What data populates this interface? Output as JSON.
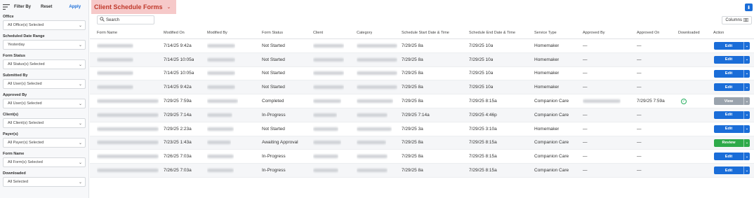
{
  "sidebar": {
    "filter_by": "Filter By",
    "reset": "Reset",
    "apply": "Apply",
    "filters": [
      {
        "label": "Office",
        "value": "All Office(s) Selected"
      },
      {
        "label": "Scheduled Date Range",
        "value": "Yesterday"
      },
      {
        "label": "Form Status",
        "value": "All Status(s) Selected"
      },
      {
        "label": "Submitted By",
        "value": "All User(s) Selected"
      },
      {
        "label": "Approved By",
        "value": "All User(s) Selected"
      },
      {
        "label": "Client(s)",
        "value": "All Client(s) Selected"
      },
      {
        "label": "Payer(s)",
        "value": "All Payer(s) Selected"
      },
      {
        "label": "Form Name",
        "value": "All Form(s) Selected"
      },
      {
        "label": "Downloaded",
        "value": "All Selected"
      }
    ]
  },
  "header": {
    "title": "Client Schedule Forms",
    "search_placeholder": "Search",
    "columns_label": "Columns"
  },
  "table": {
    "columns": [
      "Form Name",
      "Modified On",
      "Modified By",
      "Form Status",
      "Client",
      "Category",
      "Schedule Start Date & Time",
      "Schedule End Date & Time",
      "Service Type",
      "Approved By",
      "Approved On",
      "Downloaded",
      "Action"
    ],
    "rows": [
      {
        "modified_on": "7/14/25 9:42a",
        "status": "Not Started",
        "start": "7/29/25 8a",
        "end": "7/29/25 10a",
        "service": "Homemaker",
        "approved_by": "—",
        "approved_on": "—",
        "action": "Edit"
      },
      {
        "modified_on": "7/14/25 10:05a",
        "status": "Not Started",
        "start": "7/29/25 8a",
        "end": "7/29/25 10a",
        "service": "Homemaker",
        "approved_by": "—",
        "approved_on": "—",
        "action": "Edit"
      },
      {
        "modified_on": "7/14/25 10:05a",
        "status": "Not Started",
        "start": "7/29/25 8a",
        "end": "7/29/25 10a",
        "service": "Homemaker",
        "approved_by": "—",
        "approved_on": "—",
        "action": "Edit"
      },
      {
        "modified_on": "7/14/25 9:42a",
        "status": "Not Started",
        "start": "7/29/25 8a",
        "end": "7/29/25 10a",
        "service": "Homemaker",
        "approved_by": "—",
        "approved_on": "—",
        "action": "Edit"
      },
      {
        "modified_on": "7/29/25 7:59a",
        "status": "Completed",
        "start": "7/29/25 8a",
        "end": "7/29/25 8:15a",
        "service": "Companion Care",
        "approved_by": "",
        "approved_on": "7/29/25 7:59a",
        "downloaded": true,
        "action": "View"
      },
      {
        "modified_on": "7/29/25 7:14a",
        "status": "In-Progress",
        "start": "7/29/25 7:14a",
        "end": "7/29/25 4:46p",
        "service": "Companion Care",
        "approved_by": "—",
        "approved_on": "—",
        "action": "Edit"
      },
      {
        "modified_on": "7/29/25 2:23a",
        "status": "Not Started",
        "start": "7/29/25 3a",
        "end": "7/29/25 3:10a",
        "service": "Homemaker",
        "approved_by": "—",
        "approved_on": "—",
        "action": "Edit"
      },
      {
        "modified_on": "7/23/25 1:43a",
        "status": "Awaiting Approval",
        "start": "7/29/25 8a",
        "end": "7/29/25 8:15a",
        "service": "Companion Care",
        "approved_by": "—",
        "approved_on": "—",
        "action": "Review"
      },
      {
        "modified_on": "7/26/25 7:03a",
        "status": "In-Progress",
        "start": "7/29/25 8a",
        "end": "7/29/25 8:15a",
        "service": "Companion Care",
        "approved_by": "—",
        "approved_on": "—",
        "action": "Edit"
      },
      {
        "modified_on": "7/26/25 7:03a",
        "status": "In-Progress",
        "start": "7/29/25 8a",
        "end": "7/29/25 8:15a",
        "service": "Companion Care",
        "approved_by": "—",
        "approved_on": "—",
        "action": "Edit"
      }
    ]
  },
  "colors": {
    "accent": "#1a6dd8",
    "title": "#c0392b",
    "title_bg": "#f6c9c9",
    "review": "#2eaa4a",
    "view": "#9aa3ad"
  }
}
